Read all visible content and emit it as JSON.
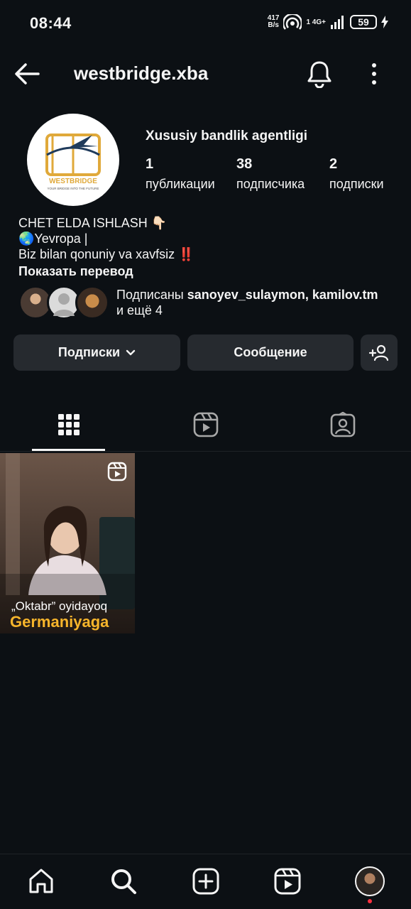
{
  "status_bar": {
    "time": "08:44",
    "net_speed": "417",
    "net_unit": "B/s",
    "signal_label": "1 4G+",
    "battery": "59"
  },
  "header": {
    "username": "westbridge.xba"
  },
  "profile": {
    "avatar_logo_text": "WESTBRIDGE",
    "avatar_logo_tagline": "YOUR BRIDGE INTO THE FUTURE",
    "full_name": "Xususiy bandlik agentligi",
    "stats": [
      {
        "value": "1",
        "label": "публикации"
      },
      {
        "value": "38",
        "label": "подписчика"
      },
      {
        "value": "2",
        "label": "подписки"
      }
    ],
    "bio_lines": [
      "CHET ELDA ISHLASH 👇🏻",
      "🌏Yevropa |",
      "Biz bilan qonuniy va xavfsiz ‼️"
    ],
    "translate_label": "Показать перевод",
    "followed_by": {
      "prefix": "Подписаны ",
      "names": "sanoyev_sulaymon, kamilov.tm",
      "and_more": "и ещё 4"
    }
  },
  "actions": {
    "following_label": "Подписки",
    "message_label": "Сообщение"
  },
  "tabs": [
    {
      "icon": "grid-icon",
      "active": true
    },
    {
      "icon": "reels-icon",
      "active": false
    },
    {
      "icon": "tagged-icon",
      "active": false
    }
  ],
  "posts": [
    {
      "caption_line1": "„Oktabr” oyidayoq",
      "caption_line2": "Germaniyaga",
      "type": "reel"
    }
  ],
  "bottom_nav": [
    "home-icon",
    "search-icon",
    "create-icon",
    "reels-icon",
    "profile-avatar"
  ],
  "colors": {
    "background": "#0c1014",
    "button": "#262a2f",
    "accent_orange": "#f7b52b",
    "notification_dot": "#ff3040"
  }
}
